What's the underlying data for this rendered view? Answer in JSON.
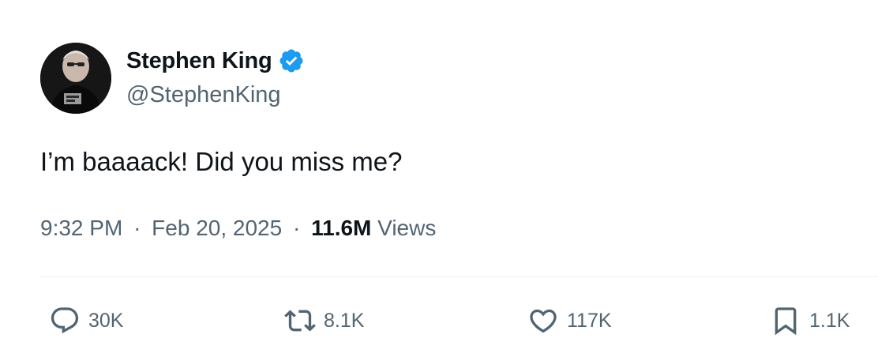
{
  "author": {
    "display_name": "Stephen King",
    "handle": "@StephenKing",
    "verified": true,
    "verified_color": "#1d9bf0"
  },
  "tweet": {
    "text": "I’m baaaack! Did you miss me?",
    "time": "9:32 PM",
    "date": "Feb 20, 2025",
    "separator": "·",
    "views_count": "11.6M",
    "views_label": "Views"
  },
  "actions": {
    "replies": {
      "icon": "reply-icon",
      "count": "30K"
    },
    "reposts": {
      "icon": "repost-icon",
      "count": "8.1K"
    },
    "likes": {
      "icon": "heart-icon",
      "count": "117K"
    },
    "bookmarks": {
      "icon": "bookmark-icon",
      "count": "1.1K"
    }
  },
  "colors": {
    "text_primary": "#0f1419",
    "text_secondary": "#536471",
    "divider": "#eff3f4"
  }
}
